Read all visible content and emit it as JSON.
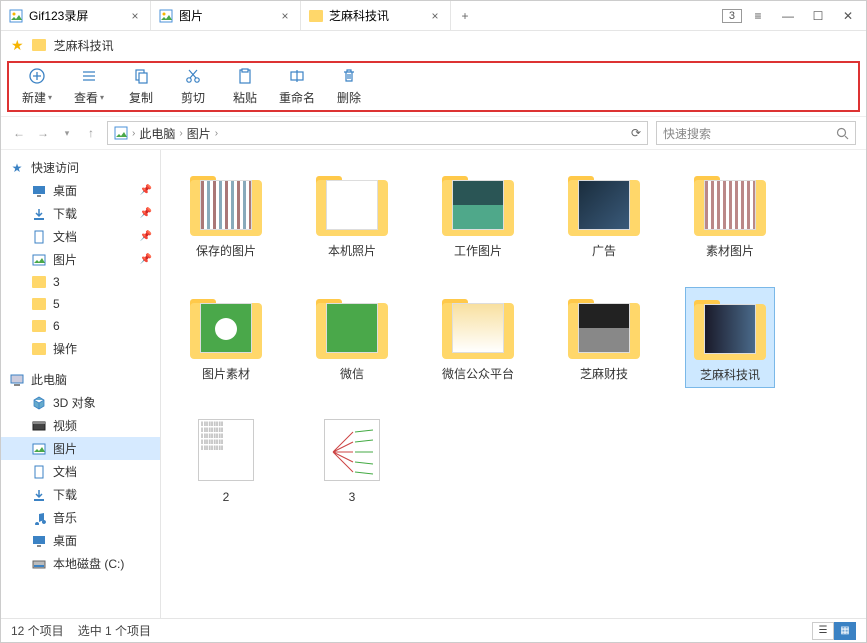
{
  "titlebar": {
    "tabs": [
      {
        "icon": "image-file",
        "label": "Gif123录屏"
      },
      {
        "icon": "folder",
        "label": "图片"
      },
      {
        "icon": "folder",
        "label": "芝麻科技讯"
      }
    ],
    "tab_count": "3"
  },
  "crumb": {
    "label": "芝麻科技讯"
  },
  "toolbar": {
    "items": [
      {
        "icon": "plus-circle",
        "label": "新建",
        "dropdown": true
      },
      {
        "icon": "list",
        "label": "查看",
        "dropdown": true
      },
      {
        "icon": "copy",
        "label": "复制",
        "dropdown": false
      },
      {
        "icon": "cut",
        "label": "剪切",
        "dropdown": false
      },
      {
        "icon": "paste",
        "label": "粘贴",
        "dropdown": false
      },
      {
        "icon": "rename",
        "label": "重命名",
        "dropdown": false
      },
      {
        "icon": "trash",
        "label": "删除",
        "dropdown": false
      }
    ]
  },
  "address": {
    "segments": [
      "此电脑",
      "图片"
    ],
    "search_placeholder": "快速搜索"
  },
  "sidebar": {
    "quick_access": {
      "label": "快速访问",
      "items": [
        {
          "icon": "desktop",
          "label": "桌面",
          "pinned": true
        },
        {
          "icon": "download",
          "label": "下载",
          "pinned": true
        },
        {
          "icon": "document",
          "label": "文档",
          "pinned": true
        },
        {
          "icon": "image",
          "label": "图片",
          "pinned": true
        },
        {
          "icon": "folder",
          "label": "3",
          "pinned": false
        },
        {
          "icon": "folder",
          "label": "5",
          "pinned": false
        },
        {
          "icon": "folder",
          "label": "6",
          "pinned": false
        },
        {
          "icon": "folder",
          "label": "操作",
          "pinned": false
        }
      ]
    },
    "this_pc": {
      "label": "此电脑",
      "items": [
        {
          "icon": "3d",
          "label": "3D 对象"
        },
        {
          "icon": "video",
          "label": "视频"
        },
        {
          "icon": "image",
          "label": "图片",
          "selected": true
        },
        {
          "icon": "document",
          "label": "文档"
        },
        {
          "icon": "download",
          "label": "下载"
        },
        {
          "icon": "music",
          "label": "音乐"
        },
        {
          "icon": "desktop",
          "label": "桌面"
        },
        {
          "icon": "disk",
          "label": "本地磁盘 (C:)"
        }
      ]
    }
  },
  "content": {
    "items": [
      {
        "type": "folder",
        "preview": "p1",
        "label": "保存的图片"
      },
      {
        "type": "folder",
        "preview": "p2",
        "label": "本机照片"
      },
      {
        "type": "folder",
        "preview": "p3",
        "label": "工作图片"
      },
      {
        "type": "folder",
        "preview": "p4",
        "label": "广告"
      },
      {
        "type": "folder",
        "preview": "p5",
        "label": "素材图片"
      },
      {
        "type": "folder",
        "preview": "p6",
        "label": "图片素材"
      },
      {
        "type": "folder",
        "preview": "p7",
        "label": "微信"
      },
      {
        "type": "folder",
        "preview": "p8",
        "label": "微信公众平台"
      },
      {
        "type": "folder",
        "preview": "p9",
        "label": "芝麻财技"
      },
      {
        "type": "folder",
        "preview": "p10",
        "label": "芝麻科技讯",
        "selected": true
      },
      {
        "type": "file",
        "preview": "sheet",
        "label": "2"
      },
      {
        "type": "file",
        "preview": "diagram",
        "label": "3"
      }
    ]
  },
  "statusbar": {
    "count": "12 个项目",
    "selection": "选中 1 个项目"
  }
}
